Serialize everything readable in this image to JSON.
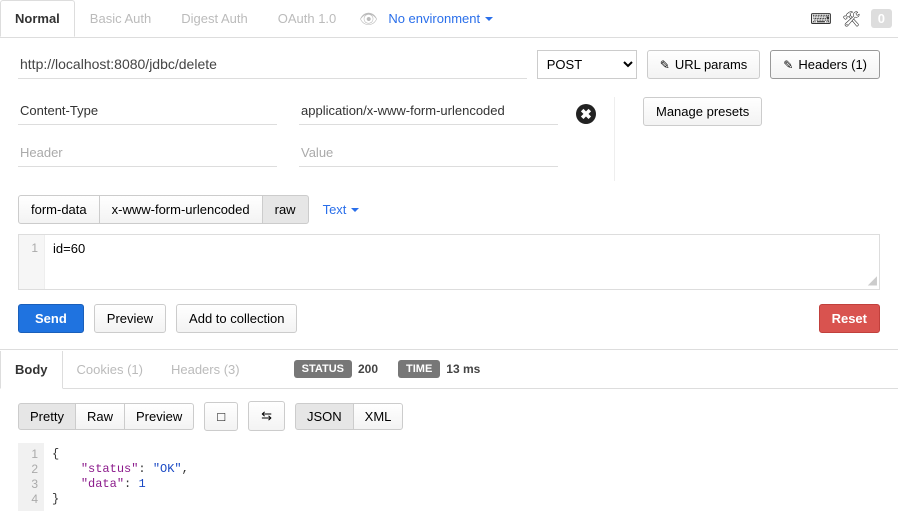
{
  "top_tabs": {
    "normal": "Normal",
    "basic": "Basic Auth",
    "digest": "Digest Auth",
    "oauth": "OAuth 1.0"
  },
  "environment_label": "No environment",
  "top_right_badge": "0",
  "request": {
    "url": "http://localhost:8080/jdbc/delete",
    "method": "POST",
    "url_params_btn": "URL params",
    "headers_btn": "Headers (1)"
  },
  "headers": {
    "key1": "Content-Type",
    "val1": "application/x-www-form-urlencoded",
    "key_ph": "Header",
    "val_ph": "Value",
    "manage_presets": "Manage presets"
  },
  "body_types": {
    "form": "form-data",
    "urlenc": "x-www-form-urlencoded",
    "raw": "raw",
    "text_dd": "Text"
  },
  "body_editor": {
    "line1": "1",
    "content": "id=60"
  },
  "actions": {
    "send": "Send",
    "preview": "Preview",
    "add": "Add to collection",
    "reset": "Reset"
  },
  "response": {
    "tabs": {
      "body": "Body",
      "cookies": "Cookies (1)",
      "headers": "Headers (3)"
    },
    "status_label": "STATUS",
    "status_code": "200",
    "time_label": "TIME",
    "time_value": "13 ms",
    "tools": {
      "pretty": "Pretty",
      "raw": "Raw",
      "preview": "Preview",
      "json": "JSON",
      "xml": "XML"
    },
    "json": {
      "l1": "{",
      "l2_indent": "    ",
      "l2_key": "\"status\"",
      "l2_colon": ": ",
      "l2_val": "\"OK\"",
      "l2_comma": ",",
      "l3_indent": "    ",
      "l3_key": "\"data\"",
      "l3_colon": ": ",
      "l3_val": "1",
      "l4": "}",
      "gut1": "1",
      "gut2": "2",
      "gut3": "3",
      "gut4": "4"
    }
  }
}
